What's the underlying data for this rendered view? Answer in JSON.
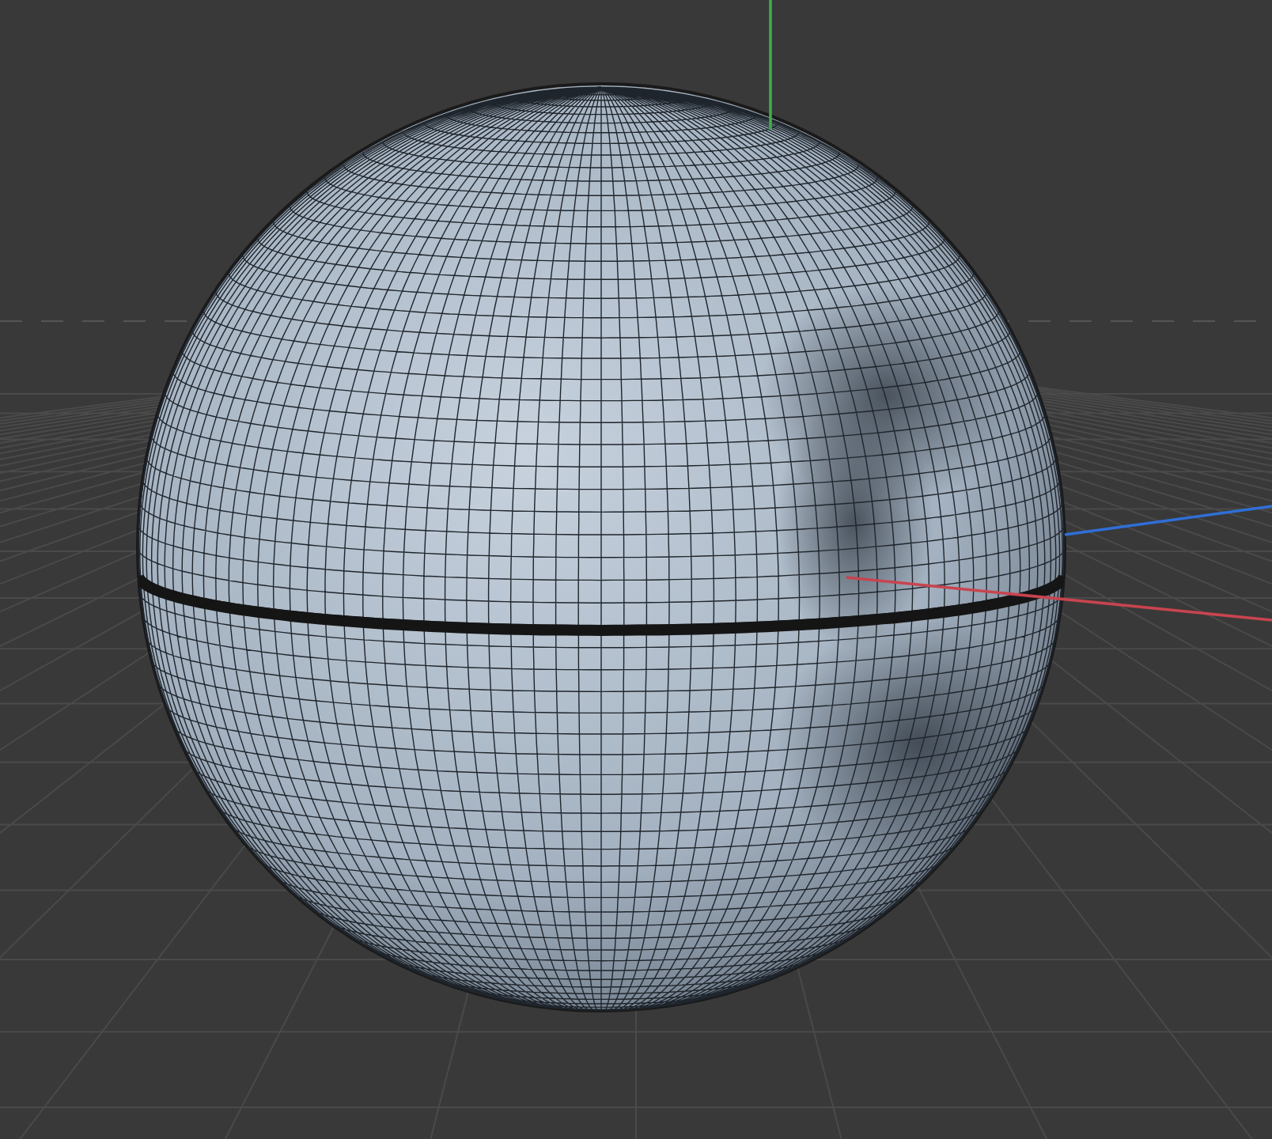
{
  "viewport": {
    "axes": [
      {
        "kind": "y",
        "color": "#3fae4a"
      },
      {
        "kind": "x",
        "color": "#c8444f"
      },
      {
        "kind": "z",
        "color": "#2f6fd6"
      }
    ]
  }
}
